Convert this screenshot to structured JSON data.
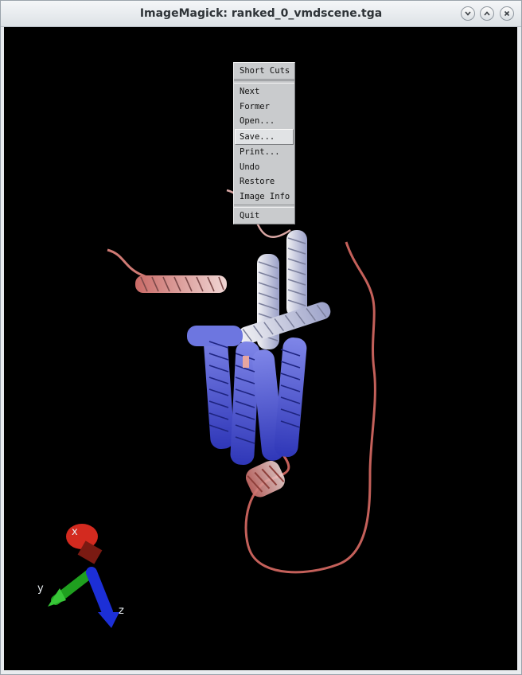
{
  "window": {
    "title": "ImageMagick: ranked_0_vmdscene.tga"
  },
  "menu": {
    "title": "Short Cuts",
    "items": [
      "Next",
      "Former",
      "Open...",
      "Save...",
      "Print...",
      "Undo",
      "Restore",
      "Image Info",
      "Quit"
    ],
    "highlighted": "Save..."
  },
  "axes": {
    "x_label": "x",
    "y_label": "y",
    "z_label": "z"
  },
  "colors": {
    "background": "#000000",
    "helix_blue": "#4b55d6",
    "helix_white": "#d8dbe3",
    "coil_red": "#c9605b"
  }
}
